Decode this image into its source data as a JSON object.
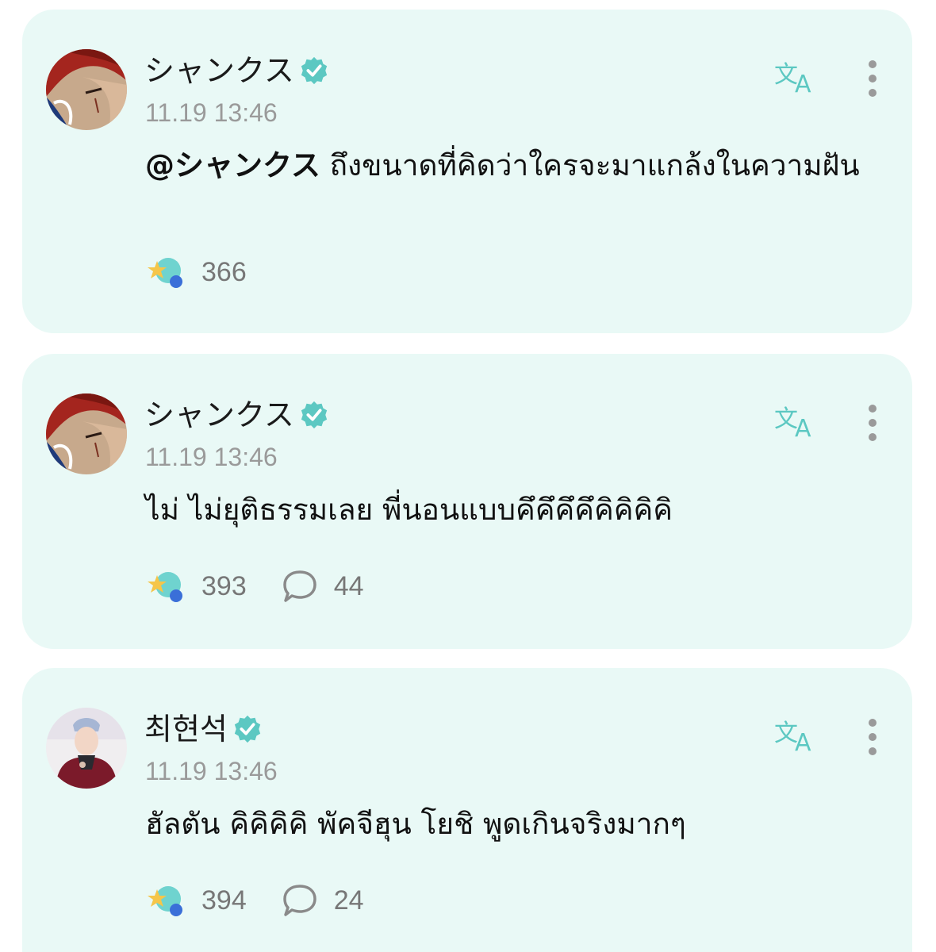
{
  "colors": {
    "card_bg": "#e9f9f6",
    "accent": "#5cc8c2",
    "timestamp": "#9a9a9a",
    "count": "#777777"
  },
  "icons": {
    "verified": "verified-badge-icon",
    "translate": "translate-icon",
    "more": "more-vertical-icon",
    "reaction": "star-bubble-reaction-icon",
    "comment": "comment-bubble-icon"
  },
  "posts": [
    {
      "author": "シャンクス",
      "verified": true,
      "time": "11.19 13:46",
      "mention": "@シャンクス",
      "text": " ถึงขนาดที่คิดว่าใครจะมาแกล้งในความฝัน",
      "reactions": "366",
      "comments": null
    },
    {
      "author": "シャンクス",
      "verified": true,
      "time": "11.19 13:46",
      "mention": "",
      "text": "ไม่ ไม่ยุติธรรมเลย พี่นอนแบบคึคึคึคึคิคิคิคิ",
      "reactions": "393",
      "comments": "44"
    },
    {
      "author": "최현석",
      "verified": true,
      "time": "11.19 13:46",
      "mention": "",
      "text": "ฮัลตัน คิคิคิคิ พัคจีฮุน โยชิ พูดเกินจริงมากๆ",
      "reactions": "394",
      "comments": "24"
    }
  ]
}
